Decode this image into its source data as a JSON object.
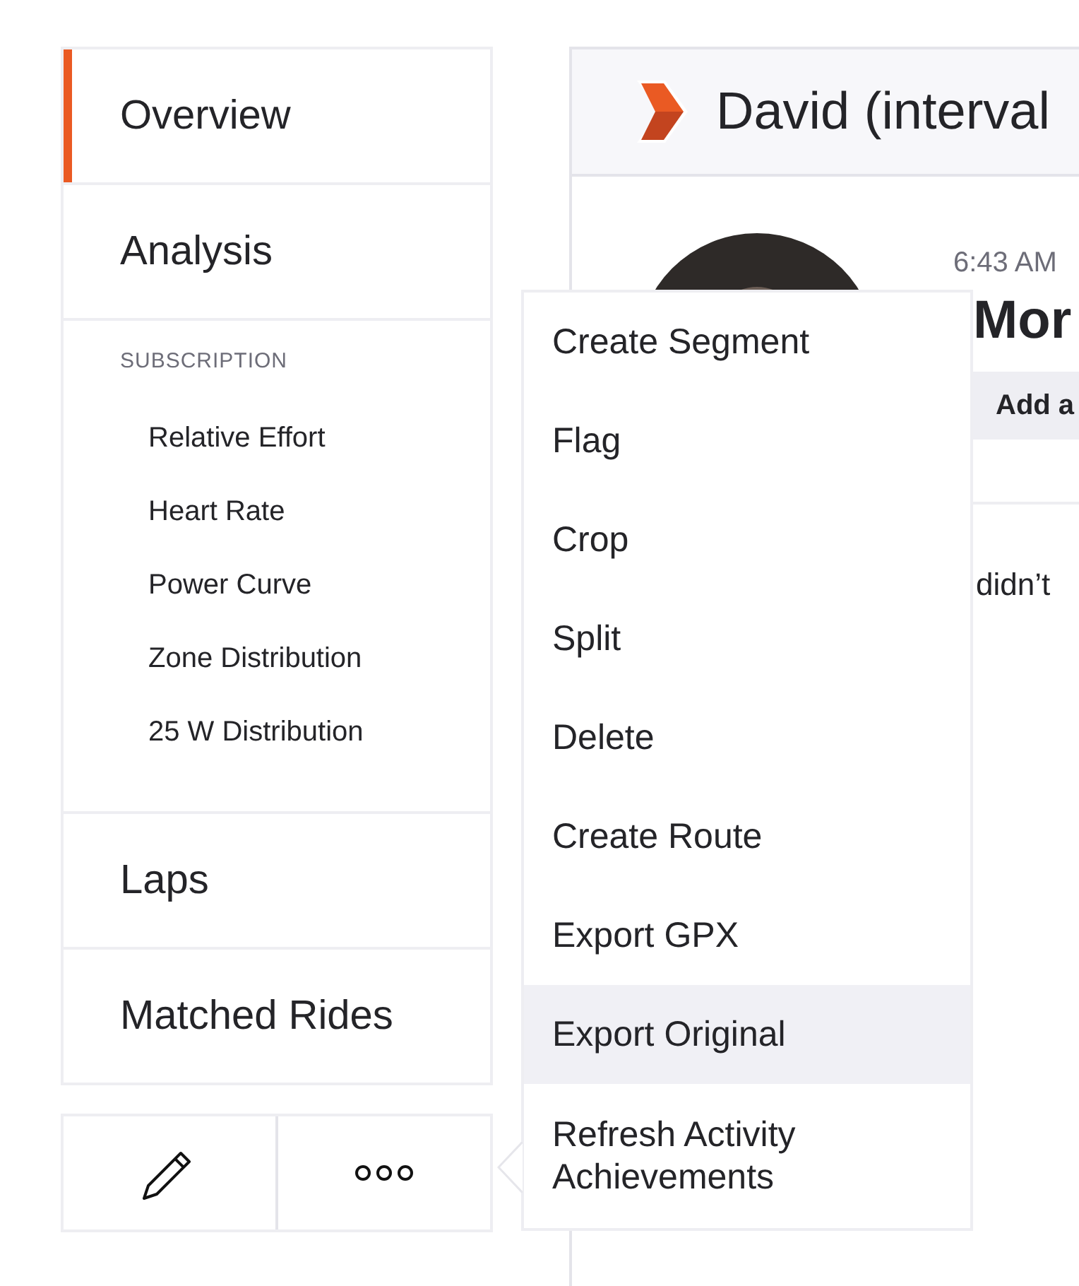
{
  "sidebar": {
    "items": [
      {
        "label": "Overview",
        "selected": true
      },
      {
        "label": "Analysis",
        "selected": false
      }
    ],
    "section": {
      "heading": "SUBSCRIPTION",
      "items": [
        "Relative Effort",
        "Heart Rate",
        "Power Curve",
        "Zone Distribution",
        "25 W Distribution"
      ]
    },
    "items_after": [
      {
        "label": "Laps",
        "selected": false
      },
      {
        "label": "Matched Rides",
        "selected": false
      }
    ]
  },
  "activity": {
    "athlete": "David (interval",
    "time": "6:43 AM",
    "title": "Mor",
    "add_button": "Add a",
    "text": "didn’t"
  },
  "menu": {
    "items": [
      {
        "label": "Create Segment",
        "selected": false
      },
      {
        "label": "Flag",
        "selected": false
      },
      {
        "label": "Crop",
        "selected": false
      },
      {
        "label": "Split",
        "selected": false
      },
      {
        "label": "Delete",
        "selected": false
      },
      {
        "label": "Create Route",
        "selected": false
      },
      {
        "label": "Export GPX",
        "selected": false
      },
      {
        "label": "Export Original",
        "selected": true
      },
      {
        "label": "Refresh Activity Achievements",
        "selected": false
      }
    ]
  }
}
